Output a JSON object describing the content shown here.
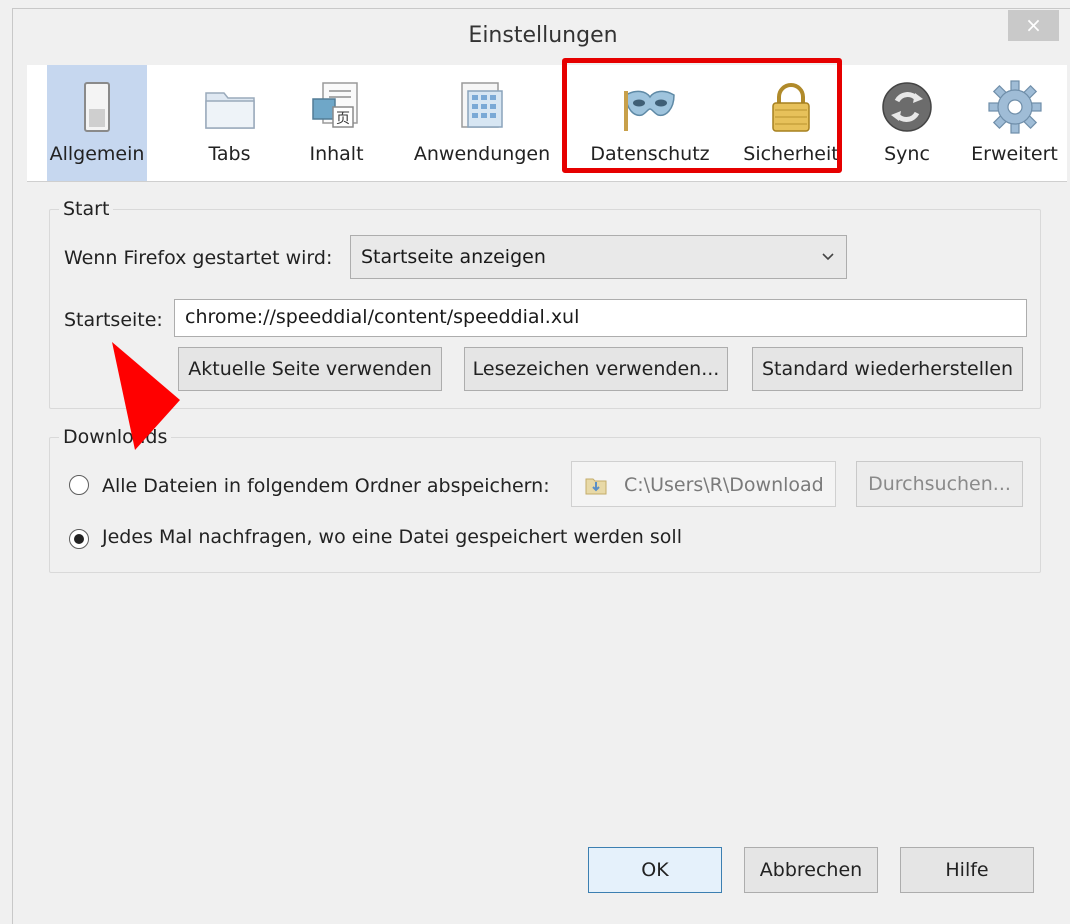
{
  "window": {
    "title": "Einstellungen",
    "close_glyph": "×"
  },
  "toolbar": {
    "panes": [
      {
        "label": "Allgemein",
        "icon": "switch-icon",
        "selected": true
      },
      {
        "label": "Tabs",
        "icon": "folder-icon",
        "selected": false
      },
      {
        "label": "Inhalt",
        "icon": "content-icon",
        "selected": false
      },
      {
        "label": "Anwendungen",
        "icon": "applications-icon",
        "selected": false
      },
      {
        "label": "Datenschutz",
        "icon": "mask-icon",
        "selected": false
      },
      {
        "label": "Sicherheit",
        "icon": "padlock-icon",
        "selected": false
      },
      {
        "label": "Sync",
        "icon": "sync-icon",
        "selected": false
      },
      {
        "label": "Erweitert",
        "icon": "gear-icon",
        "selected": false
      }
    ]
  },
  "start": {
    "legend": "Start",
    "when_label": "Wenn Firefox gestartet wird:",
    "when_value": "Startseite anzeigen",
    "homepage_label": "Startseite:",
    "homepage_value": "chrome://speeddial/content/speeddial.xul",
    "btn_current": "Aktuelle Seite verwenden",
    "btn_bookmarks": "Lesezeichen verwenden...",
    "btn_restore": "Standard wiederherstellen"
  },
  "downloads": {
    "legend": "Downloads",
    "option_folder": "Alle Dateien in folgendem Ordner abspeichern:",
    "folder_value": "C:\\Users\\R\\Download",
    "browse": "Durchsuchen...",
    "option_ask": "Jedes Mal nachfragen, wo eine Datei gespeichert werden soll",
    "selected_option": "ask"
  },
  "footer": {
    "ok": "OK",
    "cancel": "Abbrechen",
    "help": "Hilfe"
  },
  "colors": {
    "highlight_box": "#e60000",
    "annotation_arrow": "#ff0000",
    "selected_pane": "#c6d7ef"
  }
}
